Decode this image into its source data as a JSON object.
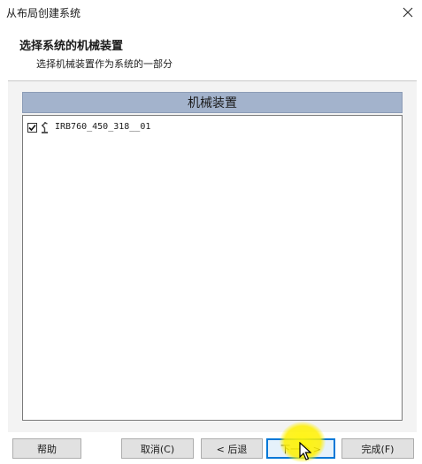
{
  "window": {
    "title": "从布局创建系统",
    "close_icon": "close-icon"
  },
  "header": {
    "heading": "选择系统的机械装置",
    "subheading": "选择机械装置作为系统的一部分"
  },
  "mechanisms": {
    "column_header": "机械装置",
    "items": [
      {
        "label": "IRB760_450_318__01",
        "checked": true,
        "icon": "robot-icon"
      }
    ]
  },
  "buttons": {
    "help": "帮助",
    "cancel": "取消(C)",
    "back": "< 后退",
    "next": "下一个 >",
    "finish": "完成(F)"
  },
  "colors": {
    "column_header_bg": "#a3b3cc",
    "highlight": "#fff200",
    "focus_border": "#0078d7"
  }
}
